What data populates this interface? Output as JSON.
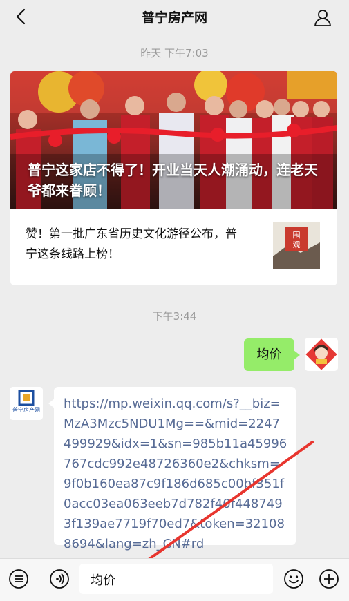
{
  "header": {
    "title": "普宁房产网"
  },
  "timestamps": {
    "first": "昨天 下午7:03",
    "second": "下午3:44"
  },
  "article_card": {
    "main_title": "普宁这家店不得了！开业当天人潮涌动，连老天爷都来眷顾！",
    "sub_title": "赞！第一批广东省历史文化游径公布，普宁这条线路上榜！",
    "thumb_text": "围观"
  },
  "messages": {
    "sent_text": "均价",
    "received_link": "https://mp.weixin.qq.com/s?__biz=MzA3Mzc5NDU1Mg==&mid=2247499929&idx=1&sn=985b11a45996767cdc992e48726360e2&chksm=9f0b160ea87c9f186d685c00bf351f0acc03ea063eeb7d782f40f4487493f139ae7719f70ed7&token=321088694&lang=zh_CN#rd",
    "logo_label": "普宁房产网"
  },
  "input": {
    "value": "均价"
  },
  "colors": {
    "green_bubble": "#95ec69",
    "link": "#576b95",
    "arrow": "#e8352e"
  }
}
